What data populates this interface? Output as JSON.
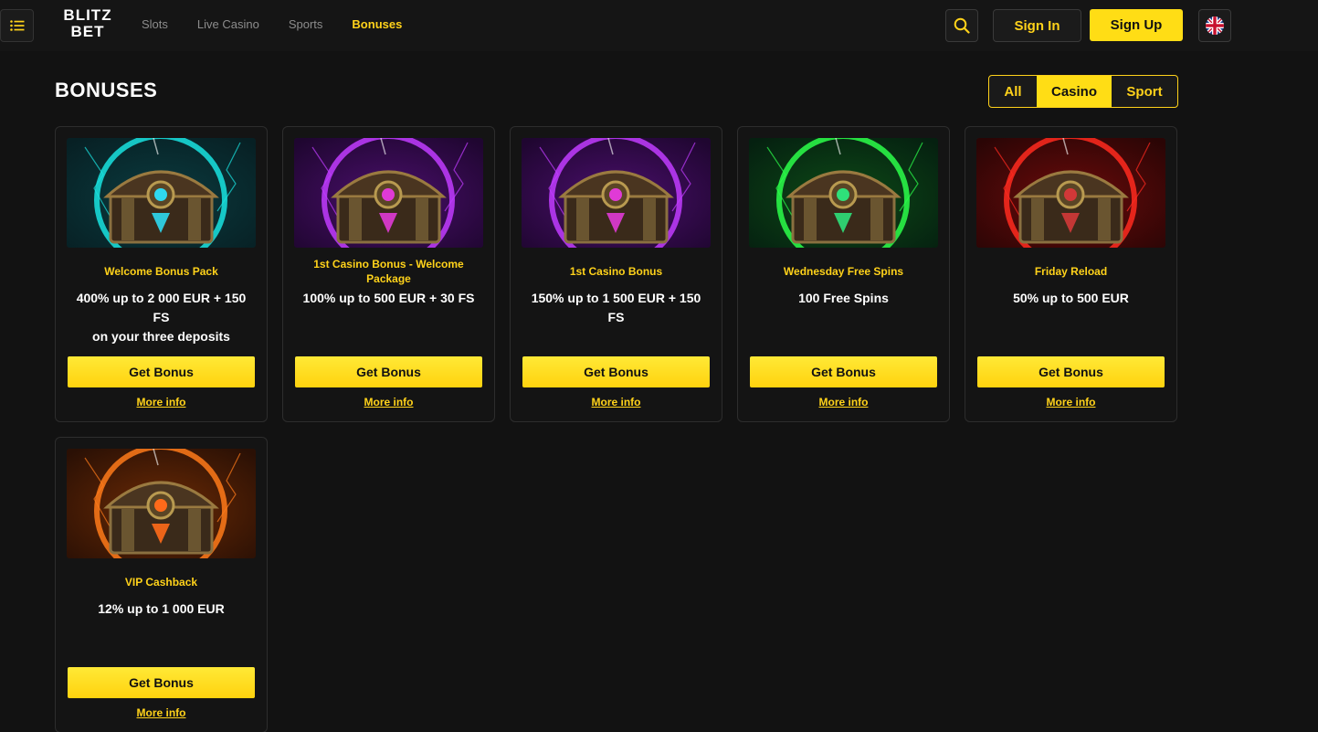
{
  "header": {
    "logo_line1": "BLITZ",
    "logo_line2": "BET",
    "nav": [
      "Slots",
      "Live Casino",
      "Sports",
      "Bonuses"
    ],
    "active_nav": "Bonuses",
    "sign_in": "Sign In",
    "sign_up": "Sign Up",
    "icons": {
      "menu": "list-icon",
      "search": "search-icon",
      "language": "uk-flag-icon"
    }
  },
  "page": {
    "title": "BONUSES",
    "filter": {
      "options": [
        "All",
        "Casino",
        "Sport"
      ],
      "selected": "Casino"
    }
  },
  "colors": {
    "accent": "#ffd21a",
    "button": "#ffdd15",
    "background": "#121212"
  },
  "bonuses": [
    {
      "title": "Welcome Bonus Pack",
      "line1": "400% up to 2 000 EUR + 150 FS",
      "line2": "on your three deposits",
      "button": "Get Bonus",
      "more": "More info",
      "theme": "teal"
    },
    {
      "title": "1st Casino Bonus - Welcome Package",
      "line1": "100% up to 500 EUR + 30 FS",
      "line2": "",
      "button": "Get Bonus",
      "more": "More info",
      "theme": "purple"
    },
    {
      "title": "1st Casino Bonus",
      "line1": "150% up to 1 500 EUR + 150 FS",
      "line2": "",
      "button": "Get Bonus",
      "more": "More info",
      "theme": "purple"
    },
    {
      "title": "Wednesday Free Spins",
      "line1": "100 Free Spins",
      "line2": "",
      "button": "Get Bonus",
      "more": "More info",
      "theme": "green"
    },
    {
      "title": "Friday Reload",
      "line1": "50% up to 500 EUR",
      "line2": "",
      "button": "Get Bonus",
      "more": "More info",
      "theme": "red"
    },
    {
      "title": "VIP Cashback",
      "line1": "12% up to 1 000 EUR",
      "line2": "",
      "button": "Get Bonus",
      "more": "More info",
      "theme": "orange"
    }
  ]
}
